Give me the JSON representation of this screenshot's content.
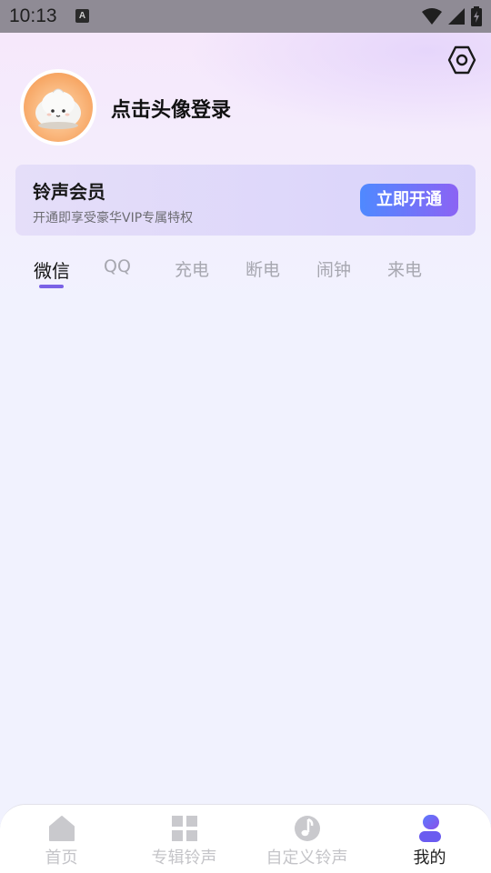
{
  "status_bar": {
    "time": "10:13",
    "notification_icon": "A"
  },
  "profile": {
    "login_prompt": "点击头像登录"
  },
  "vip": {
    "title": "铃声会员",
    "subtitle": "开通即享受豪华VIP专属特权",
    "button_label": "立即开通"
  },
  "tabs": [
    {
      "label": "微信",
      "active": true
    },
    {
      "label": "QQ",
      "active": false
    },
    {
      "label": "充电",
      "active": false
    },
    {
      "label": "断电",
      "active": false
    },
    {
      "label": "闹钟",
      "active": false
    },
    {
      "label": "来电",
      "active": false
    }
  ],
  "bottom_nav": [
    {
      "label": "首页",
      "icon": "home-icon",
      "active": false
    },
    {
      "label": "专辑铃声",
      "icon": "grid-icon",
      "active": false
    },
    {
      "label": "自定义铃声",
      "icon": "music-note-icon",
      "active": false
    },
    {
      "label": "我的",
      "icon": "profile-icon",
      "active": true
    }
  ],
  "colors": {
    "accent": "#7a62e6",
    "button_gradient_start": "#4f89ff",
    "button_gradient_end": "#8b63f4",
    "background": "#f1f2fe"
  }
}
